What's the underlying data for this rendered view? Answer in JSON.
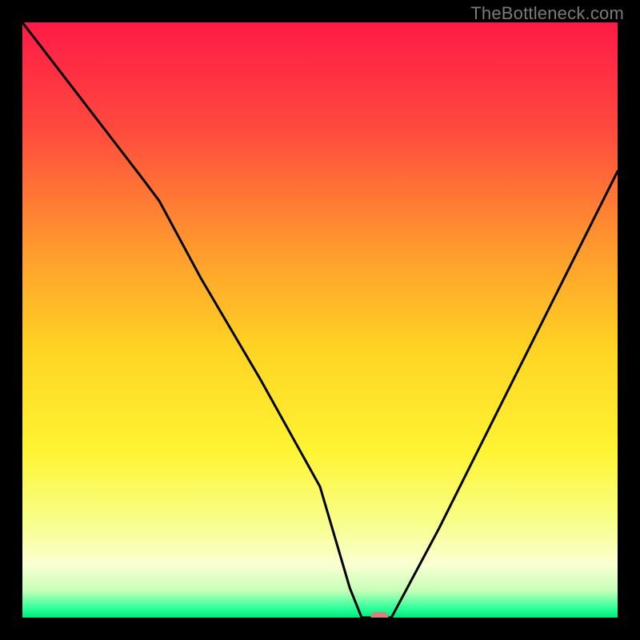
{
  "attribution": "TheBottleneck.com",
  "chart_data": {
    "type": "line",
    "title": "",
    "xlabel": "",
    "ylabel": "",
    "x_range": [
      0,
      100
    ],
    "y_range": [
      0,
      100
    ],
    "series": [
      {
        "name": "bottleneck-curve",
        "x": [
          0,
          10,
          20,
          23,
          30,
          40,
          50,
          55,
          57,
          60,
          62,
          70,
          80,
          90,
          100
        ],
        "y": [
          100,
          87,
          74,
          70,
          57,
          40,
          22,
          5,
          0,
          0,
          0,
          15,
          35,
          55,
          75
        ]
      }
    ],
    "marker": {
      "x": 60,
      "y": 0,
      "color": "#d98080"
    },
    "gradient_stops": [
      {
        "offset": 0.0,
        "color": "#ff1a47"
      },
      {
        "offset": 0.18,
        "color": "#ff4a3e"
      },
      {
        "offset": 0.38,
        "color": "#ff9a2e"
      },
      {
        "offset": 0.55,
        "color": "#ffd423"
      },
      {
        "offset": 0.72,
        "color": "#fff433"
      },
      {
        "offset": 0.84,
        "color": "#f8ff8a"
      },
      {
        "offset": 0.91,
        "color": "#faffd2"
      },
      {
        "offset": 0.955,
        "color": "#c6ffb8"
      },
      {
        "offset": 0.985,
        "color": "#2bff9a"
      },
      {
        "offset": 1.0,
        "color": "#00e87a"
      }
    ]
  }
}
